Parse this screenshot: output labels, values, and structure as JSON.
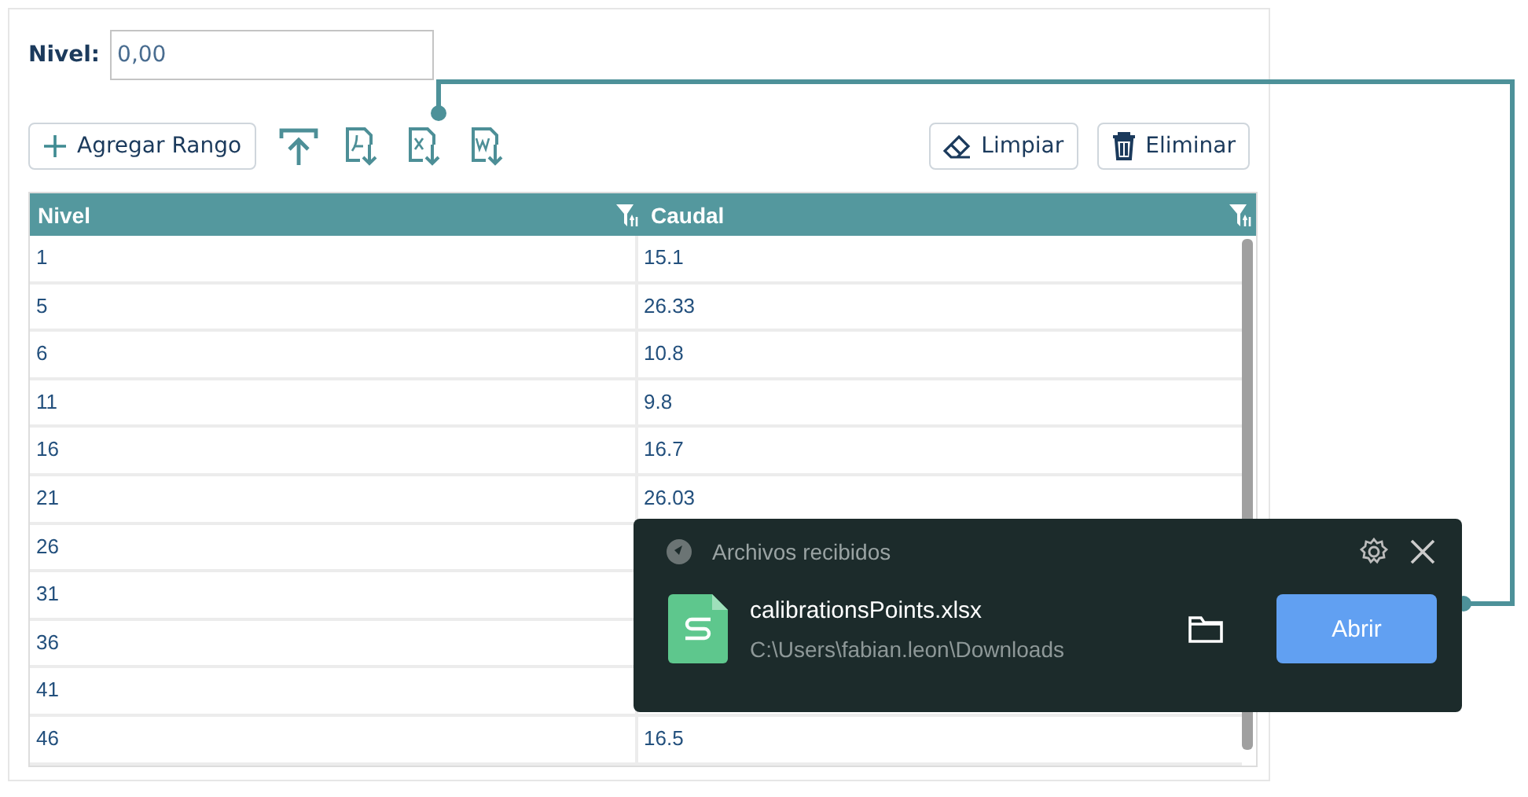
{
  "level_field": {
    "label": "Nivel:",
    "value": "0,00"
  },
  "toolbar": {
    "add_button": "Agregar Rango",
    "clear_button": "Limpiar",
    "delete_button": "Eliminar"
  },
  "table": {
    "columns": [
      "Nivel",
      "Caudal"
    ],
    "rows": [
      {
        "nivel": "1",
        "caudal": "15.1"
      },
      {
        "nivel": "5",
        "caudal": "26.33"
      },
      {
        "nivel": "6",
        "caudal": "10.8"
      },
      {
        "nivel": "11",
        "caudal": "9.8"
      },
      {
        "nivel": "16",
        "caudal": "16.7"
      },
      {
        "nivel": "21",
        "caudal": "26.03"
      },
      {
        "nivel": "26"
      },
      {
        "nivel": "31"
      },
      {
        "nivel": "36"
      },
      {
        "nivel": "41"
      },
      {
        "nivel": "46",
        "caudal": "16.5"
      }
    ]
  },
  "notification": {
    "title": "Archivos recibidos",
    "file_name": "calibrationsPoints.xlsx",
    "path": "C:\\Users\\fabian.leon\\Downloads",
    "open_button": "Abrir"
  }
}
